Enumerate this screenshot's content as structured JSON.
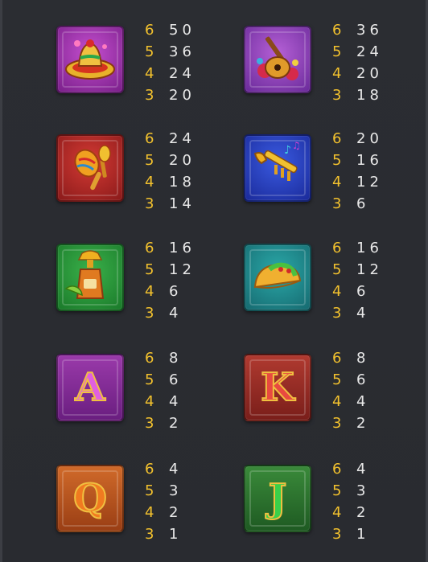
{
  "symbols": [
    {
      "icon": "sombrero-icon",
      "pays": [
        {
          "count": "6",
          "value": "50"
        },
        {
          "count": "5",
          "value": "36"
        },
        {
          "count": "4",
          "value": "24"
        },
        {
          "count": "3",
          "value": "20"
        }
      ]
    },
    {
      "icon": "guitar-icon",
      "pays": [
        {
          "count": "6",
          "value": "36"
        },
        {
          "count": "5",
          "value": "24"
        },
        {
          "count": "4",
          "value": "20"
        },
        {
          "count": "3",
          "value": "18"
        }
      ]
    },
    {
      "icon": "maracas-icon",
      "pays": [
        {
          "count": "6",
          "value": "24"
        },
        {
          "count": "5",
          "value": "20"
        },
        {
          "count": "4",
          "value": "18"
        },
        {
          "count": "3",
          "value": "14"
        }
      ]
    },
    {
      "icon": "trumpet-icon",
      "pays": [
        {
          "count": "6",
          "value": "20"
        },
        {
          "count": "5",
          "value": "16"
        },
        {
          "count": "4",
          "value": "12"
        },
        {
          "count": "3",
          "value": "6"
        }
      ]
    },
    {
      "icon": "tequila-icon",
      "pays": [
        {
          "count": "6",
          "value": "16"
        },
        {
          "count": "5",
          "value": "12"
        },
        {
          "count": "4",
          "value": "6"
        },
        {
          "count": "3",
          "value": "4"
        }
      ]
    },
    {
      "icon": "taco-icon",
      "pays": [
        {
          "count": "6",
          "value": "16"
        },
        {
          "count": "5",
          "value": "12"
        },
        {
          "count": "4",
          "value": "6"
        },
        {
          "count": "3",
          "value": "4"
        }
      ]
    },
    {
      "icon": "letter-a-icon",
      "letter": "A",
      "pays": [
        {
          "count": "6",
          "value": "8"
        },
        {
          "count": "5",
          "value": "6"
        },
        {
          "count": "4",
          "value": "4"
        },
        {
          "count": "3",
          "value": "2"
        }
      ]
    },
    {
      "icon": "letter-k-icon",
      "letter": "K",
      "pays": [
        {
          "count": "6",
          "value": "8"
        },
        {
          "count": "5",
          "value": "6"
        },
        {
          "count": "4",
          "value": "4"
        },
        {
          "count": "3",
          "value": "2"
        }
      ]
    },
    {
      "icon": "letter-q-icon",
      "letter": "Q",
      "pays": [
        {
          "count": "6",
          "value": "4"
        },
        {
          "count": "5",
          "value": "3"
        },
        {
          "count": "4",
          "value": "2"
        },
        {
          "count": "3",
          "value": "1"
        }
      ]
    },
    {
      "icon": "letter-j-icon",
      "letter": "J",
      "pays": [
        {
          "count": "6",
          "value": "4"
        },
        {
          "count": "5",
          "value": "3"
        },
        {
          "count": "4",
          "value": "2"
        },
        {
          "count": "3",
          "value": "1"
        }
      ]
    }
  ],
  "colors": {
    "count": "#f2c12e",
    "value": "#e8e8e8",
    "background": "#2a2c31"
  }
}
